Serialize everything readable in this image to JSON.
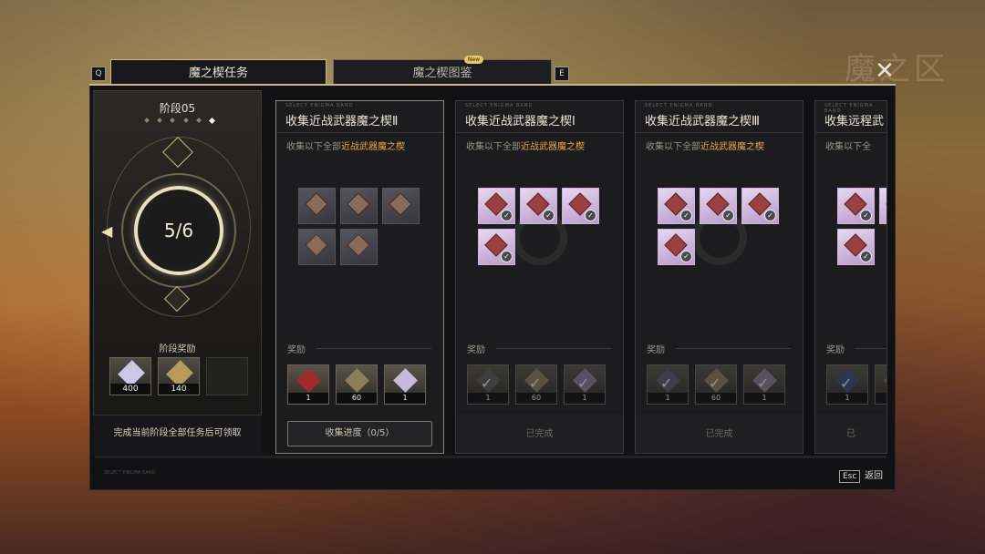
{
  "tabs": {
    "left_key": "Q",
    "right_key": "E",
    "active_label": "魔之楔任务",
    "inactive_label": "魔之楔图鉴",
    "new_badge": "New"
  },
  "background": {
    "ghost_text": "魔之区"
  },
  "stage": {
    "title": "阶段05",
    "dots_total": 6,
    "dots_active_index": 5,
    "progress": "5/6",
    "reward_label": "阶段奖励",
    "rewards": [
      {
        "icon": "crystal-icon",
        "qty": "400"
      },
      {
        "icon": "emblem-icon",
        "qty": "140"
      },
      {
        "icon": "empty-slot-icon",
        "qty": ""
      }
    ],
    "footer": "完成当前阶段全部任务后可领取"
  },
  "cards": [
    {
      "pre": "SELECT ENIGMA BAND",
      "title": "收集近战武器魔之楔Ⅱ",
      "desc_prefix": "收集以下全部",
      "desc_highlight": "近战武器魔之楔",
      "items": [
        "locked",
        "locked",
        "locked",
        "locked",
        "locked"
      ],
      "reward_label": "奖励",
      "rewards": [
        {
          "qty": "1",
          "claimed": false
        },
        {
          "qty": "60",
          "claimed": false
        },
        {
          "qty": "1",
          "claimed": false
        }
      ],
      "status": "progress",
      "button_label": "收集进度（0/5）"
    },
    {
      "pre": "SELECT ENIGMA BAND",
      "title": "收集近战武器魔之楔Ⅰ",
      "desc_prefix": "收集以下全部",
      "desc_highlight": "近战武器魔之楔",
      "items": [
        "done",
        "done",
        "done",
        "done"
      ],
      "reward_label": "奖励",
      "rewards": [
        {
          "qty": "1",
          "claimed": true
        },
        {
          "qty": "60",
          "claimed": true
        },
        {
          "qty": "1",
          "claimed": true
        }
      ],
      "status": "completed",
      "button_label": "已完成"
    },
    {
      "pre": "SELECT ENIGMA BAND",
      "title": "收集近战武器魔之楔Ⅲ",
      "desc_prefix": "收集以下全部",
      "desc_highlight": "近战武器魔之楔",
      "items": [
        "done",
        "done",
        "done",
        "done"
      ],
      "reward_label": "奖励",
      "rewards": [
        {
          "qty": "1",
          "claimed": true
        },
        {
          "qty": "60",
          "claimed": true
        },
        {
          "qty": "1",
          "claimed": true
        }
      ],
      "status": "completed",
      "button_label": "已完成"
    },
    {
      "pre": "SELECT ENIGMA BAND",
      "title": "收集远程武",
      "desc_prefix": "收集以下全",
      "desc_highlight": "",
      "items": [
        "done",
        "done",
        "done"
      ],
      "reward_label": "奖励",
      "rewards": [
        {
          "qty": "1",
          "claimed": true
        },
        {
          "qty": "",
          "claimed": true
        }
      ],
      "status": "completed",
      "button_label": "已"
    }
  ],
  "footer": {
    "tiny_text": "SELECT ENIGMA BAND",
    "esc_key": "Esc",
    "esc_label": "返回"
  }
}
